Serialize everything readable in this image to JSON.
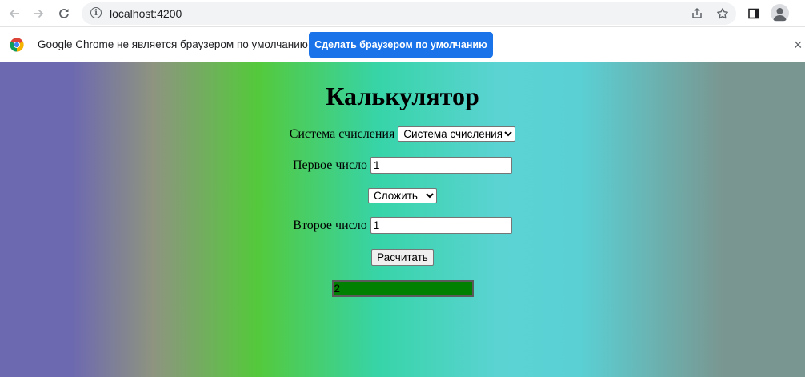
{
  "browser": {
    "url": "localhost:4200"
  },
  "infobar": {
    "message": "Google Chrome не является браузером по умолчанию.",
    "button_label": "Сделать браузером по умолчанию",
    "close_glyph": "×"
  },
  "calculator": {
    "title": "Калькулятор",
    "numeral_system_label": "Система счисления",
    "numeral_system_selected": "Система счисления",
    "first_number_label": "Первое число",
    "first_number_value": "1",
    "operation_selected": "Сложить",
    "second_number_label": "Второе число",
    "second_number_value": "1",
    "calculate_button": "Расчитать",
    "result_value": "2"
  },
  "icons": {
    "back": "back-arrow-icon",
    "forward": "forward-arrow-icon",
    "reload": "reload-icon",
    "info": "info-icon",
    "share": "share-icon",
    "bookmark": "star-icon",
    "side_panel": "side-panel-icon",
    "profile": "profile-avatar-icon",
    "chrome": "chrome-logo-icon"
  },
  "colors": {
    "infobar_button": "#1a73e8",
    "result_background": "#008000"
  }
}
